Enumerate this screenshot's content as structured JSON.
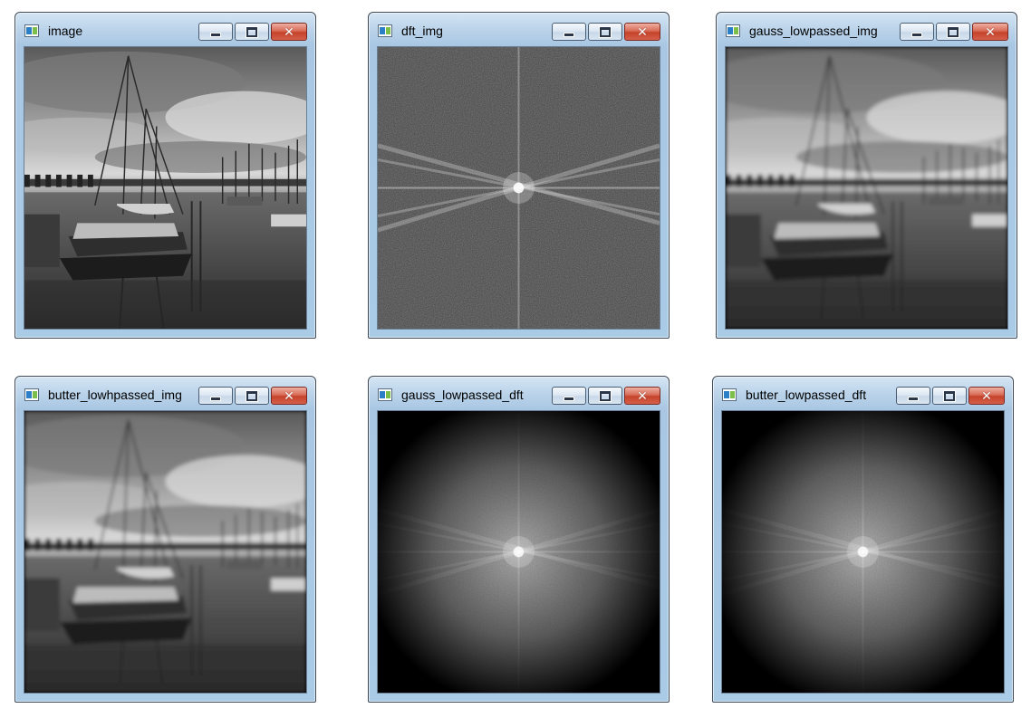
{
  "windows": [
    {
      "title": "image",
      "content": "grayscale-harbor-photo"
    },
    {
      "title": "dft_img",
      "content": "dft-magnitude-spectrum"
    },
    {
      "title": "gauss_lowpassed_img",
      "content": "blurred-harbor-photo"
    },
    {
      "title": "butter_lowhpassed_img",
      "content": "blurred-harbor-photo"
    },
    {
      "title": "gauss_lowpassed_dft",
      "content": "lowpass-filtered-spectrum"
    },
    {
      "title": "butter_lowpassed_dft",
      "content": "lowpass-filtered-spectrum"
    }
  ],
  "window_controls": {
    "minimize_icon": "minimize-icon",
    "maximize_icon": "maximize-icon",
    "close_icon": "close-icon",
    "close_glyph": "✕"
  },
  "colors": {
    "frame_blue": "#a9c7e3",
    "close_red": "#c5422a"
  }
}
